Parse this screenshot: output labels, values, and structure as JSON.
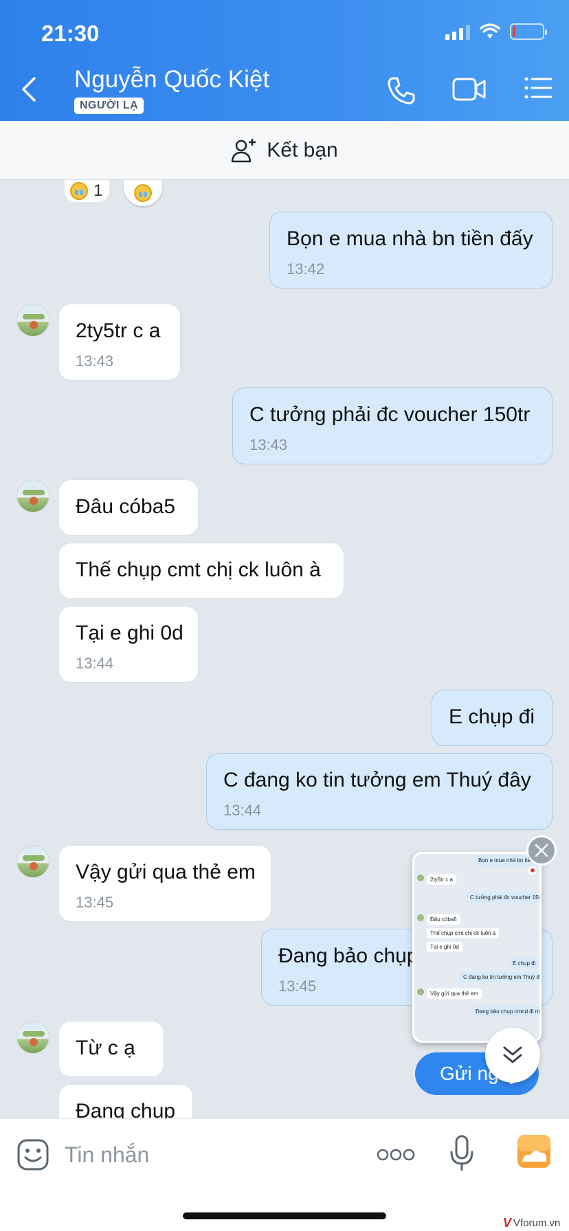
{
  "status_bar": {
    "time": "21:30"
  },
  "header": {
    "contact_name": "Nguyễn Quốc Kiệt",
    "badge": "NGƯỜI LẠ",
    "icons": [
      "back-icon",
      "phone-icon",
      "video-call-icon",
      "menu-list-icon"
    ]
  },
  "friend_bar": {
    "label": "Kết bạn",
    "icon": "add-friend-icon"
  },
  "reaction": {
    "count": "1"
  },
  "messages": [
    {
      "side": "out",
      "text": "Bọn e mua nhà bn tiền đấy",
      "time": "13:42"
    },
    {
      "side": "in",
      "text": "2ty5tr c a",
      "time": "13:43"
    },
    {
      "side": "out",
      "text": "C tưởng phải đc voucher 150tr",
      "time": "13:43"
    },
    {
      "side": "in",
      "text": " Đâu cóba5",
      "time": ""
    },
    {
      "side": "in",
      "text": "Thế chụp cmt chị ck luôn à",
      "time": ""
    },
    {
      "side": "in",
      "text": "Tại e ghi 0d",
      "time": "13:44"
    },
    {
      "side": "out",
      "text": "E chụp đi",
      "time": ""
    },
    {
      "side": "out",
      "text": "C đang ko tin tưởng em Thuý đây",
      "time": "13:44"
    },
    {
      "side": "in",
      "text": "Vậy gửi qua thẻ em",
      "time": "13:45"
    },
    {
      "side": "out",
      "text": "Đang bảo chụp",
      "time": "13:45"
    },
    {
      "side": "in",
      "text": "Từ c ạ",
      "time": ""
    },
    {
      "side": "in",
      "text": "Đang chụp",
      "time": ""
    }
  ],
  "preview": {
    "lines": [
      "Bọn e mua nhà bn tiền đấy",
      "2ty5tr c a",
      "C tưởng phải đc voucher 150tr",
      "Đâu cóba5",
      "Thế chụp cmt chị ck luôn à",
      "Tại e ghi 0d",
      "E chụp đi",
      "C đang ko tin tưởng em Thuý đây",
      "Vậy gửi qua thẻ em",
      "Đang bảo chụp cmnd đi mà"
    ]
  },
  "send_button": {
    "label": "Gửi ngay"
  },
  "input": {
    "placeholder": "Tin nhắn"
  },
  "watermark": {
    "logo": "V",
    "text": "Vforum.vn"
  },
  "colors": {
    "header": "#3d8ef0",
    "outgoing_bubble": "#d6eafc",
    "incoming_bubble": "#ffffff",
    "chat_bg": "#e2e7ee",
    "accent": "#2e86ee"
  }
}
